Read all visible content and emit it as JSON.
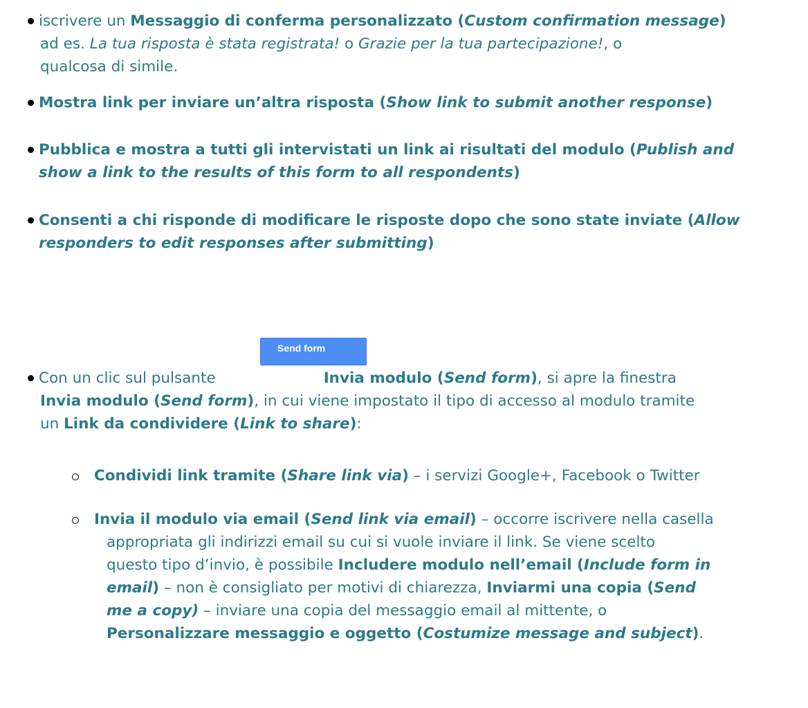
{
  "colors": {
    "text": "#2c7a89",
    "button_bg": "#4d8ef5",
    "button_text": "#ffffff"
  },
  "button": {
    "label": "Send form"
  },
  "items": {
    "b1": {
      "l1a": "iscrivere un ",
      "l1b": "Messaggio di conferma personalizzato (",
      "l1c": "Custom confirmation message",
      "l1d": ")",
      "l2a": "ad es. ",
      "l2b": "La tua risposta è stata registrata!",
      "l2c": " o ",
      "l2d": "Grazie per la tua partecipazione!",
      "l2e": ", o",
      "l3": "qualcosa di simile."
    },
    "b2": {
      "a": "Mostra link per inviare un’altra risposta (",
      "b": "Show link to submit another response",
      "c": ")"
    },
    "b3": {
      "l1a": "Pubblica e mostra a tutti gli intervistati un link ai risultati del modulo (",
      "l1b": "Publish and",
      "l2a": "show a link to the results of this form to all respondents",
      "l2b": ")"
    },
    "b4": {
      "l1a": "Consenti a chi risponde di modificare le risposte dopo che sono state inviate (",
      "l1b": "Allow",
      "l2a": "responders to edit responses after submitting",
      "l2b": ")"
    },
    "b5": {
      "l1a": "Con un clic sul pulsante",
      "l1b": "Invia modulo (",
      "l1c": "Send form",
      "l1d": ")",
      "l1e": ", si apre la finestra",
      "l2a": "Invia modulo (",
      "l2b": "Send form",
      "l2c": ")",
      "l2d": ", in cui viene impostato il tipo di accesso al modulo tramite",
      "l3a": "un ",
      "l3b": "Link da condividere (",
      "l3c": "Link to share",
      "l3d": ")",
      "l3e": ":"
    },
    "s1": {
      "a": "Condividi link tramite (",
      "b": "Share link via",
      "c": ")",
      "d": " – i servizi Google+, Facebook o Twitter"
    },
    "s2": {
      "l1a": "Invia il modulo via email (",
      "l1b": "Send link via email",
      "l1c": ")",
      "l1d": " – occorre iscrivere nella casella",
      "l2": "appropriata gli indirizzi email su cui si vuole inviare il link. Se viene scelto",
      "l3a": "questo tipo d’invio, è possibile ",
      "l3b": "Includere modulo nell’email (",
      "l3c": "Include form in",
      "l4a": "email",
      "l4b": ")",
      "l4c": " – non è consigliato per motivi di chiarezza, ",
      "l4d": "Inviarmi una copia (",
      "l4e": "Send",
      "l5a": "me a copy)",
      "l5b": " – inviare una copia del messaggio email al mittente, o",
      "l6a": "Personalizzare messaggio e oggetto (",
      "l6b": "Costumize message and subject",
      "l6c": ")",
      "l6d": "."
    }
  }
}
